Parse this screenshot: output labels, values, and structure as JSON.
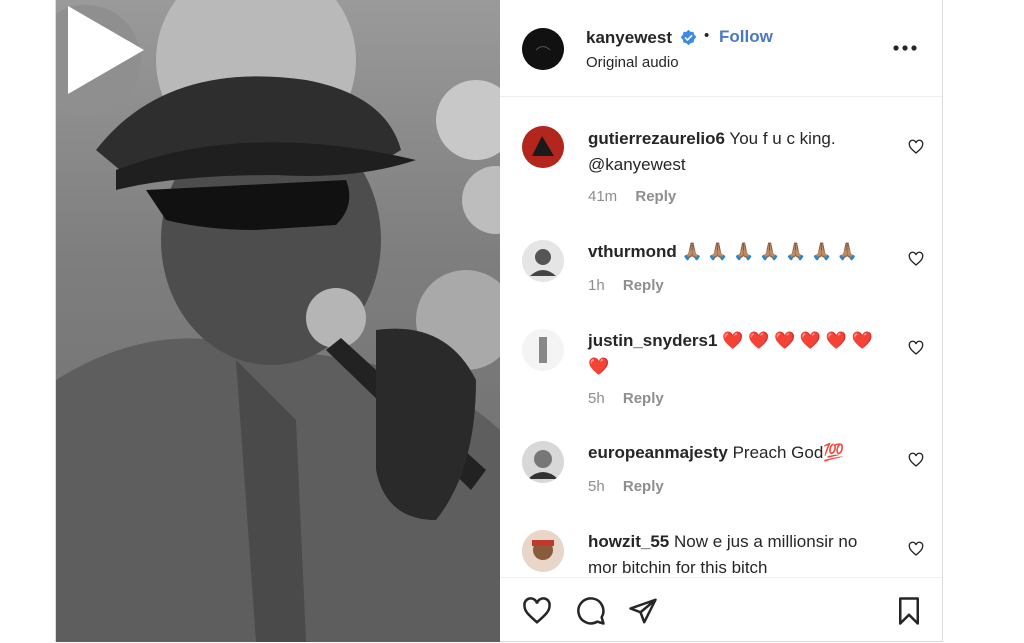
{
  "header": {
    "username": "kanyewest",
    "dot": "•",
    "follow_label": "Follow",
    "subtitle": "Original audio"
  },
  "comments": [
    {
      "user": "gutierrezaurelio6",
      "text": "You f u c king. @kanyewest",
      "time": "41m",
      "reply": "Reply"
    },
    {
      "user": "vthurmond",
      "text": "🙏🏽 🙏🏽 🙏🏽 🙏🏽 🙏🏽 🙏🏽 🙏🏽",
      "time": "1h",
      "reply": "Reply"
    },
    {
      "user": "justin_snyders1",
      "text": "❤️ ❤️ ❤️ ❤️ ❤️ ❤️ ❤️",
      "time": "5h",
      "reply": "Reply"
    },
    {
      "user": "europeanmajesty",
      "text": "Preach God💯",
      "time": "5h",
      "reply": "Reply"
    },
    {
      "user": "howzit_55",
      "text": "Now e jus a millionsir no mor bitchin for this bitch",
      "time": "",
      "reply": ""
    }
  ],
  "icons": {
    "verified": "verified-badge-icon",
    "more": "more-options-icon",
    "play": "play-icon",
    "like": "heart-icon",
    "comment": "comment-icon",
    "share": "share-icon",
    "save": "bookmark-icon"
  },
  "colors": {
    "follow": "#4a78c8",
    "text": "#262626",
    "muted": "#8e8e8e",
    "heart": "#e0245e",
    "pray": "#7a5cc7"
  }
}
